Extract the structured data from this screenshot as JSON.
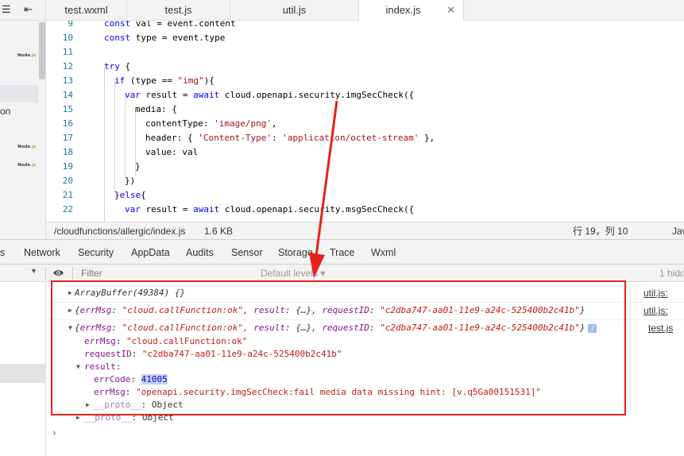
{
  "left_panel": {
    "toolbar_icons": [
      "menu-icon",
      "collapse-icon"
    ],
    "node_badge": {
      "prefix": "Node",
      "suffix": ".js"
    },
    "truncated_label": "on"
  },
  "tabs": [
    {
      "label": "test.wxml",
      "active": false
    },
    {
      "label": "test.js",
      "active": false
    },
    {
      "label": "util.js",
      "active": false
    },
    {
      "label": "index.js",
      "active": true,
      "close": "✕"
    }
  ],
  "editor": {
    "line_numbers": [
      "9",
      "10",
      "11",
      "12",
      "13",
      "14",
      "15",
      "16",
      "17",
      "18",
      "19",
      "20",
      "21",
      "22"
    ]
  },
  "status_bar": {
    "path": "/cloudfunctions/allergic/index.js",
    "size": "1.6 KB",
    "position": "行 19，列 10",
    "language": "Jav"
  },
  "devtools_tabs": [
    "s",
    "Network",
    "Security",
    "AppData",
    "Audits",
    "Sensor",
    "Storage",
    "Trace",
    "Wxml"
  ],
  "console_toolbar": {
    "filter_placeholder": "Filter",
    "level": "Default levels ▾",
    "hidden": "1 hidd"
  },
  "console": {
    "entries": [
      {
        "text": "ArrayBuffer(49384) {}",
        "source": "util.js:"
      },
      {
        "source": "util.js:"
      },
      {
        "source": "test.js"
      }
    ],
    "errMsg_ok": "\"cloud.callFunction:ok\"",
    "requestID": "\"c2dba747-aa01-11e9-a24c-525400b2c41b\"",
    "result_summary": "{…}",
    "errCode": "41005",
    "errMsg_fail": "\"openapi.security.imgSecCheck:fail media data missing hint: [v.q5Ga00151531]\"",
    "proto_label": "__proto__",
    "proto_value": "Object",
    "info_badge": "i",
    "prompt": "›"
  },
  "annotation": {
    "color": "#e5231a"
  }
}
